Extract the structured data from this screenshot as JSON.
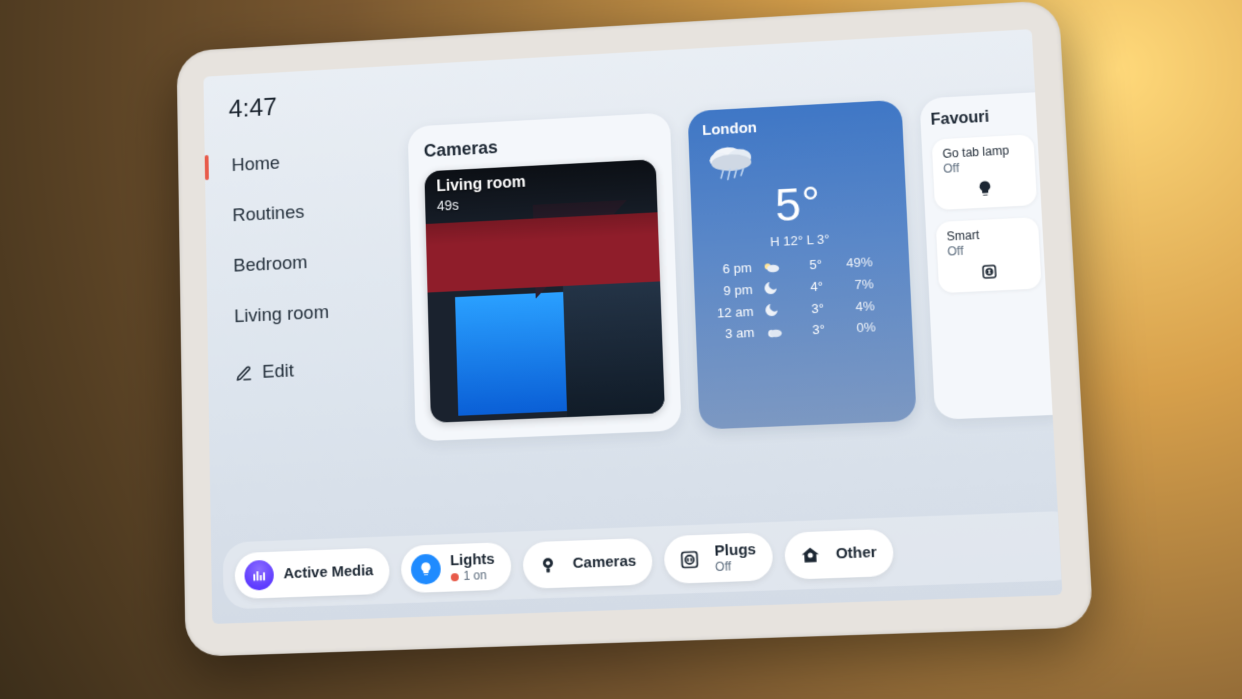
{
  "clock": "4:47",
  "nav": {
    "items": [
      "Home",
      "Routines",
      "Bedroom",
      "Living room"
    ],
    "selected_index": 0,
    "edit_label": "Edit"
  },
  "cameras": {
    "title": "Cameras",
    "feed_name": "Living room",
    "feed_age": "49s"
  },
  "weather": {
    "location": "London",
    "temperature": "5°",
    "high_low": "H 12°  L 3°",
    "hours": [
      {
        "time": "6 pm",
        "icon": "cloud-sun",
        "temp": "5°",
        "precip": "49%"
      },
      {
        "time": "9 pm",
        "icon": "moon",
        "temp": "4°",
        "precip": "7%"
      },
      {
        "time": "12 am",
        "icon": "moon",
        "temp": "3°",
        "precip": "4%"
      },
      {
        "time": "3 am",
        "icon": "cloud-moon",
        "temp": "3°",
        "precip": "0%"
      }
    ]
  },
  "favourites": {
    "title": "Favouri",
    "tiles": [
      {
        "name": "Go tab lamp",
        "state": "Off",
        "icon": "bulb-icon"
      },
      {
        "name": "Smart",
        "state": "Off",
        "icon": "plug-icon"
      }
    ]
  },
  "chips": {
    "active_media": "Active Media",
    "lights": {
      "label": "Lights",
      "status": "1 on"
    },
    "cameras": "Cameras",
    "plugs": {
      "label": "Plugs",
      "status": "Off"
    },
    "other": "Other"
  }
}
